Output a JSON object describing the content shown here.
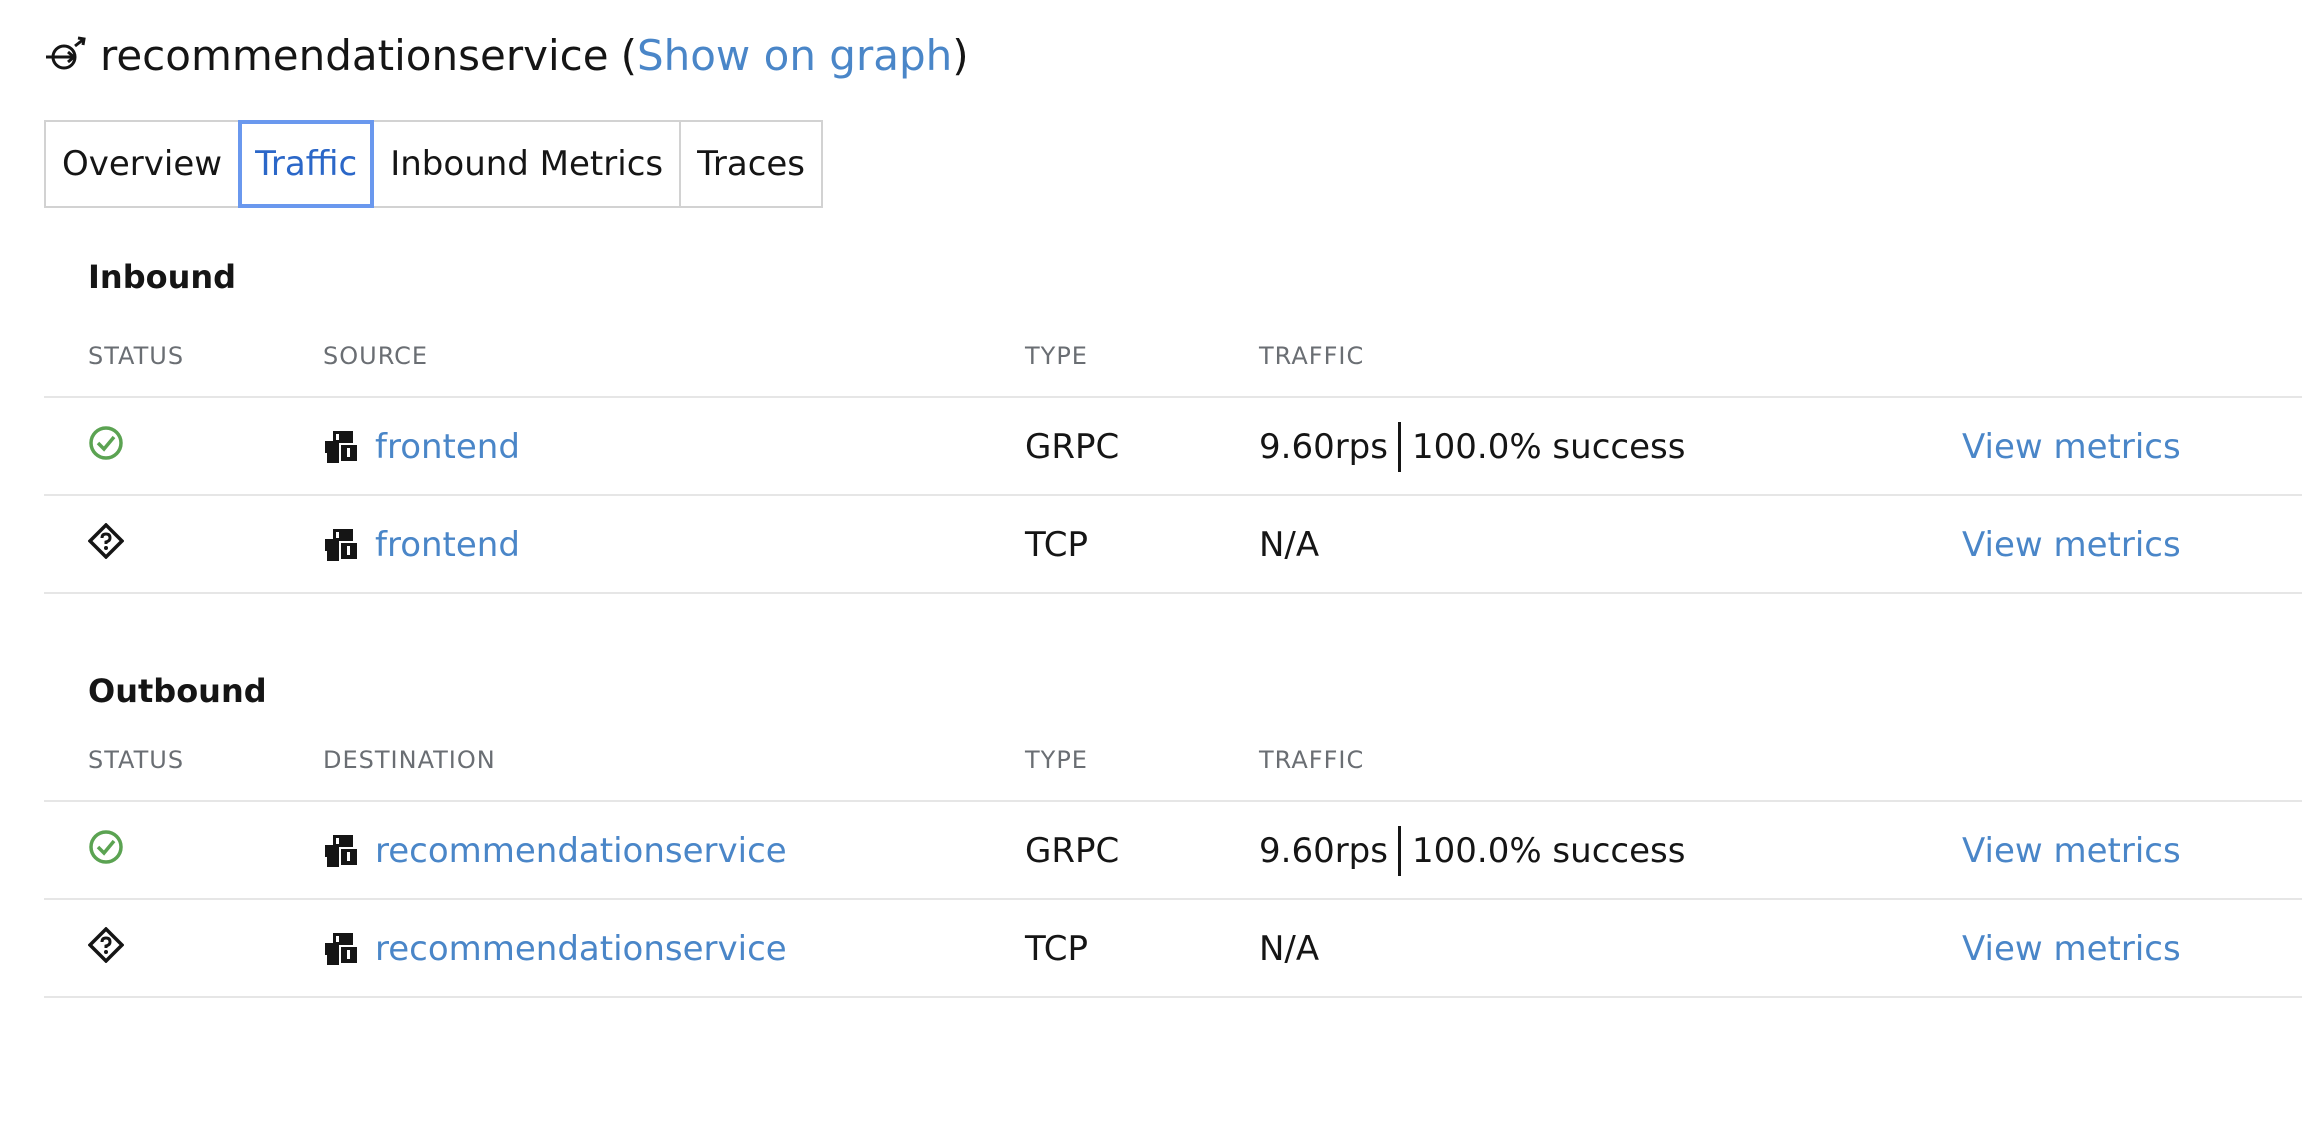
{
  "header": {
    "icon": "service-icon",
    "name": "recommendationservice",
    "open_paren": "(",
    "show_on_graph": "Show on graph",
    "close_paren": ")"
  },
  "tabs": [
    {
      "label": "Overview",
      "active": false
    },
    {
      "label": "Traffic",
      "active": true
    },
    {
      "label": "Inbound Metrics",
      "active": false
    },
    {
      "label": "Traces",
      "active": false
    }
  ],
  "inbound": {
    "title": "Inbound",
    "columns": {
      "status": "STATUS",
      "source": "SOURCE",
      "type": "TYPE",
      "traffic": "TRAFFIC"
    },
    "rows": [
      {
        "status": "healthy",
        "status_icon": "check-circle-icon",
        "name": "frontend",
        "name_icon": "workloads-icon",
        "type": "GRPC",
        "rps": "9.60rps",
        "success": "100.0% success",
        "traffic": "",
        "link": "View metrics"
      },
      {
        "status": "unknown",
        "status_icon": "question-diamond-icon",
        "name": "frontend",
        "name_icon": "workloads-icon",
        "type": "TCP",
        "rps": "",
        "success": "",
        "traffic": "N/A",
        "link": "View metrics"
      }
    ]
  },
  "outbound": {
    "title": "Outbound",
    "columns": {
      "status": "STATUS",
      "destination": "DESTINATION",
      "type": "TYPE",
      "traffic": "TRAFFIC"
    },
    "rows": [
      {
        "status": "healthy",
        "status_icon": "check-circle-icon",
        "name": "recommendationservice",
        "name_icon": "workloads-icon",
        "type": "GRPC",
        "rps": "9.60rps",
        "success": "100.0% success",
        "traffic": "",
        "link": "View metrics"
      },
      {
        "status": "unknown",
        "status_icon": "question-diamond-icon",
        "name": "recommendationservice",
        "name_icon": "workloads-icon",
        "type": "TCP",
        "rps": "",
        "success": "",
        "traffic": "N/A",
        "link": "View metrics"
      }
    ]
  },
  "colors": {
    "link": "#4a86c8",
    "success": "#5ba352",
    "active_tab": "#6a98ee"
  }
}
